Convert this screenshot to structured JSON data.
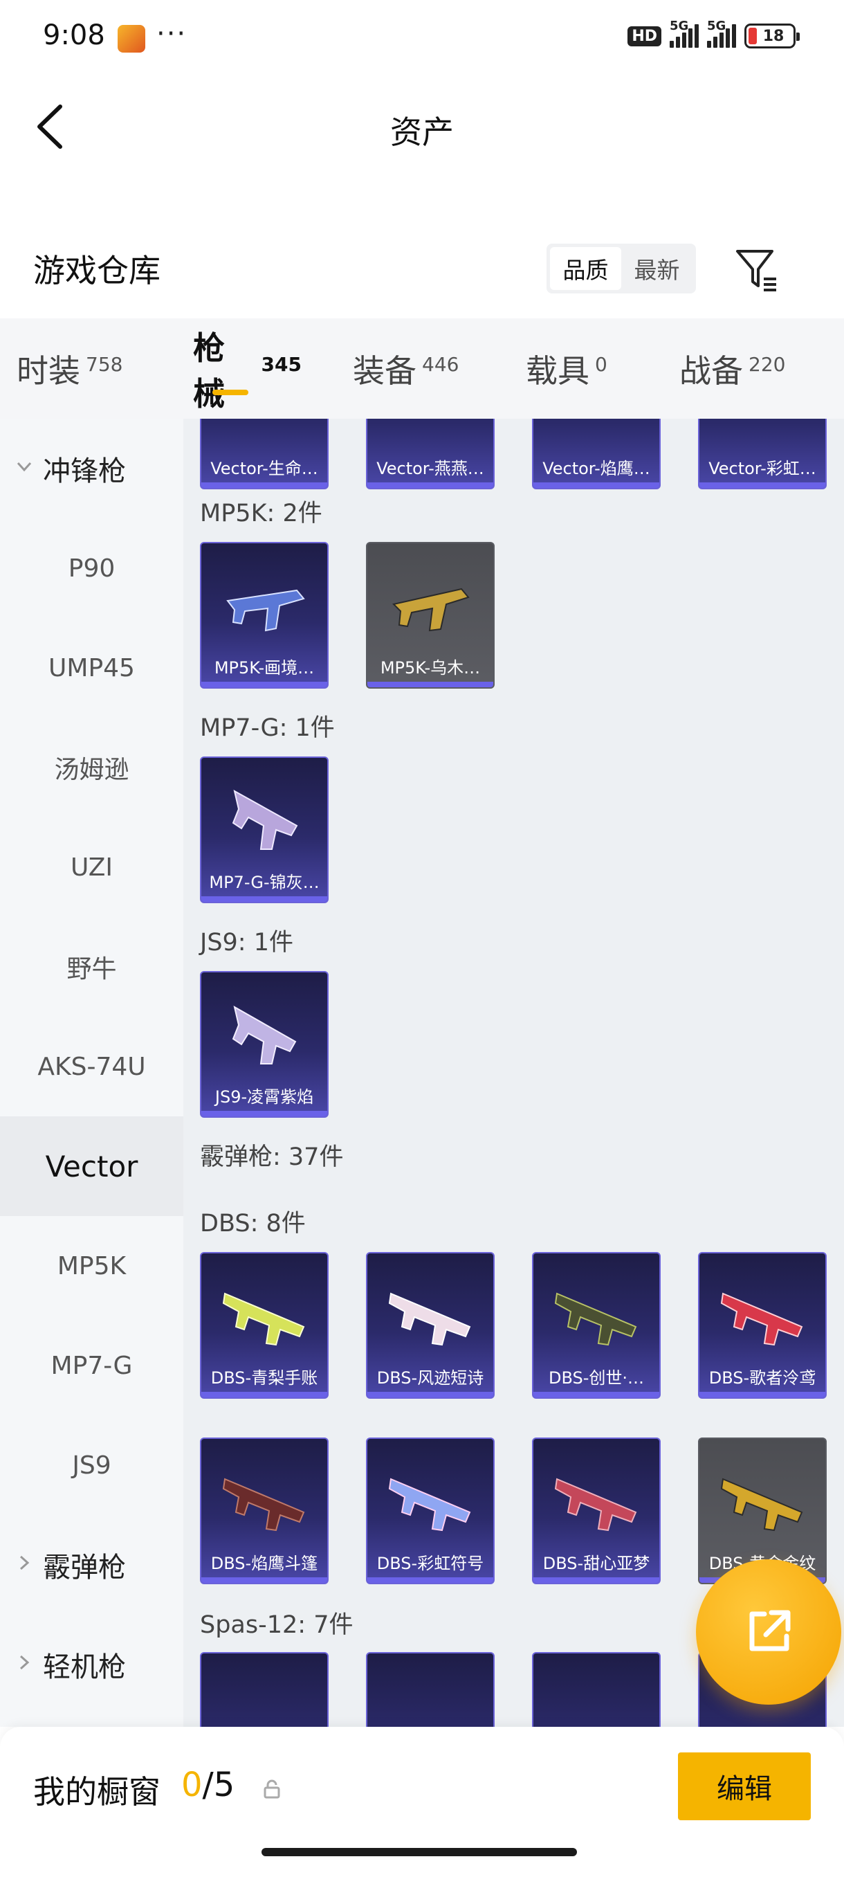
{
  "status_bar": {
    "time": "9:08",
    "dots": "···",
    "hd": "HD",
    "net1": "5G",
    "net2": "5G",
    "battery": "18"
  },
  "header": {
    "title": "资产"
  },
  "warehouse": {
    "title": "游戏仓库",
    "sort_options": [
      "品质",
      "最新"
    ],
    "active_sort": 0
  },
  "category_tabs": [
    {
      "label": "时装",
      "count": "758"
    },
    {
      "label": "枪械",
      "count": "345",
      "active": true
    },
    {
      "label": "装备",
      "count": "446"
    },
    {
      "label": "载具",
      "count": "0"
    },
    {
      "label": "战备",
      "count": "220"
    }
  ],
  "sidebar": {
    "group_smg": "冲锋枪",
    "items": [
      "P90",
      "UMP45",
      "汤姆逊",
      "UZI",
      "野牛",
      "AKS-74U",
      "Vector",
      "MP5K",
      "MP7-G",
      "JS9"
    ],
    "active_item": "Vector",
    "group_shotgun": "霰弹枪",
    "group_lmg": "轻机枪"
  },
  "content": {
    "vector_row": [
      "Vector-生命…",
      "Vector-燕燕…",
      "Vector-焰鹰…",
      "Vector-彩虹…"
    ],
    "mp5k": {
      "label": "MP5K: 2件",
      "items": [
        "MP5K-画境…",
        "MP5K-乌木…"
      ]
    },
    "mp7g": {
      "label": "MP7-G: 1件",
      "items": [
        "MP7-G-锦灰…"
      ]
    },
    "js9": {
      "label": "JS9: 1件",
      "items": [
        "JS9-凌霄紫焰"
      ]
    },
    "shotgun_label": "霰弹枪: 37件",
    "dbs": {
      "label": "DBS: 8件",
      "items": [
        "DBS-青梨手账",
        "DBS-风迹短诗",
        "DBS-创世·…",
        "DBS-歌者泠鸢",
        "DBS-焰鹰斗篷",
        "DBS-彩虹符号",
        "DBS-甜心亚梦",
        "DBS-黄金金纹"
      ]
    },
    "spas": {
      "label": "Spas-12: 7件"
    }
  },
  "showcase": {
    "label": "我的橱窗",
    "current": "0",
    "sep": "/",
    "max": "5",
    "edit_label": "编辑"
  },
  "colors": {
    "accent": "#f5b400",
    "card_purple": "#2b2a6a",
    "card_grey": "#5c5d63"
  }
}
